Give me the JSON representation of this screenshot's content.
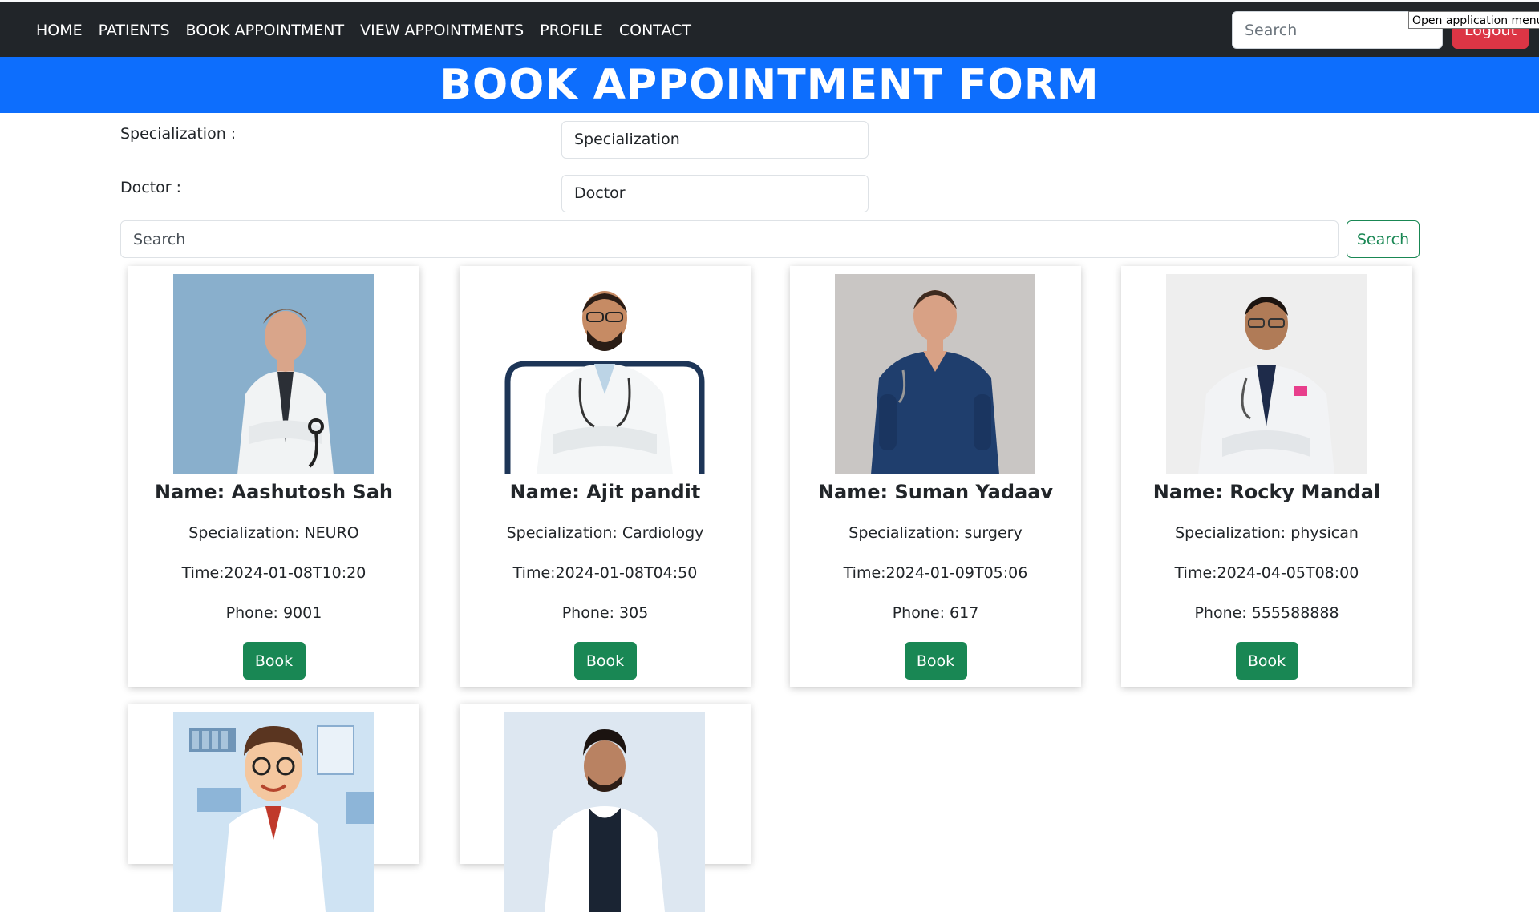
{
  "nav": {
    "links": [
      "HOME",
      "PATIENTS",
      "BOOK APPOINTMENT",
      "VIEW APPOINTMENTS",
      "PROFILE",
      "CONTACT"
    ],
    "search_placeholder": "Search",
    "logout_label": "Logout",
    "tooltip": "Open application menu"
  },
  "banner": {
    "title": "BOOK APPOINTMENT FORM"
  },
  "form": {
    "specialization_label": "Specialization :",
    "specialization_value": "Specialization",
    "doctor_label": "Doctor :",
    "doctor_value": "Doctor",
    "search_placeholder": "Search",
    "search_button": "Search"
  },
  "doctors": [
    {
      "name": "Name: Aashutosh Sah",
      "specialization": "Specialization: NEURO",
      "time": "Time:2024-01-08T10:20",
      "phone": "Phone: 9001",
      "book_label": "Book",
      "photo": "doctor-photo-white-coat"
    },
    {
      "name": "Name: Ajit pandit",
      "specialization": "Specialization: Cardiology",
      "time": "Time:2024-01-08T04:50",
      "phone": "Phone: 305",
      "book_label": "Book",
      "photo": "doctor-photo-arms-crossed"
    },
    {
      "name": "Name: Suman Yadaav",
      "specialization": "Specialization: surgery",
      "time": "Time:2024-01-09T05:06",
      "phone": "Phone: 617",
      "book_label": "Book",
      "photo": "doctor-photo-scrubs"
    },
    {
      "name": "Name: Rocky Mandal",
      "specialization": "Specialization: physican",
      "time": "Time:2024-04-05T08:00",
      "phone": "Phone: 555588888",
      "book_label": "Book",
      "photo": "doctor-photo-glasses"
    },
    {
      "photo": "doctor-cartoon-illustration"
    },
    {
      "photo": "doctor-photo-young"
    }
  ],
  "colors": {
    "navbar": "#212529",
    "banner": "#0d6efd",
    "success": "#198754",
    "danger": "#dc3545"
  }
}
